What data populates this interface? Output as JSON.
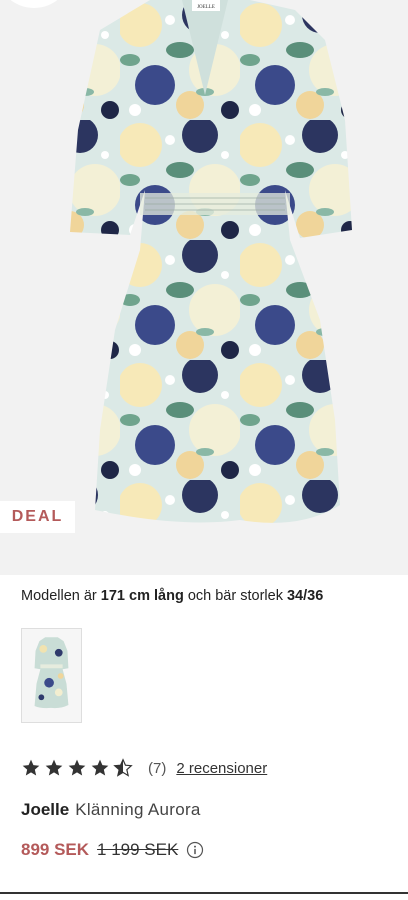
{
  "badge": {
    "label": "DEAL"
  },
  "model_info": {
    "prefix": "Modellen är ",
    "height": "171 cm lång",
    "middle": " och bär storlek ",
    "size": "34/36"
  },
  "rating": {
    "value": 4.5,
    "max": 5,
    "count_label": "(7)",
    "reviews_link": "2 recensioner"
  },
  "product": {
    "brand": "Joelle",
    "name": "Klänning Aurora",
    "label_text": "JOELLE"
  },
  "price": {
    "sale": "899 SEK",
    "original": "1 199 SEK"
  },
  "colors": {
    "sale_price": "#b45a5a",
    "deal_badge": "#b45a5a",
    "star": "#333333"
  },
  "icons": {
    "info": "info-icon",
    "star": "star-icon"
  }
}
